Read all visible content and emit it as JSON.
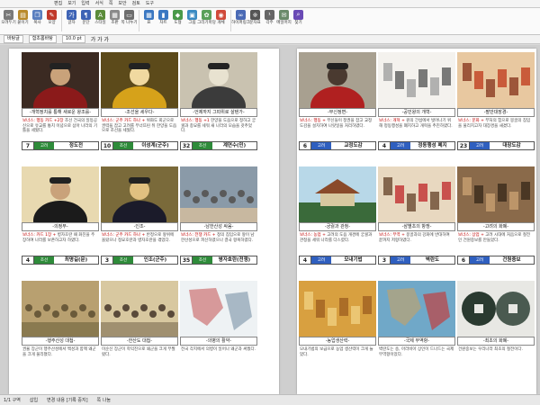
{
  "ribbon_tabs": [
    "편집",
    "보기",
    "입력",
    "서식",
    "쪽",
    "보안",
    "검토",
    "도구"
  ],
  "ribbon": [
    {
      "label": "오려두기",
      "icon": "scissors-icon",
      "color": "#7a7a7a",
      "glyph": "✂"
    },
    {
      "label": "붙이기",
      "icon": "paste-icon",
      "color": "#b98a2b",
      "glyph": "▤"
    },
    {
      "label": "복사",
      "icon": "copy-icon",
      "color": "#5a7fbf",
      "glyph": "❐"
    },
    {
      "label": "모양",
      "icon": "format-copy-icon",
      "color": "#c0392b",
      "glyph": "✎"
    },
    {
      "label": "글자",
      "icon": "char-shape-icon",
      "color": "#3e63b5",
      "glyph": "가"
    },
    {
      "label": "문단",
      "icon": "paragraph-icon",
      "color": "#3e63b5",
      "glyph": "¶"
    },
    {
      "label": "스타일",
      "icon": "style-icon",
      "color": "#5b8c3a",
      "glyph": "A"
    },
    {
      "label": "조판",
      "icon": "layout-icon",
      "color": "#8a8a8a",
      "glyph": "▦"
    },
    {
      "label": "쪽 나누기",
      "icon": "page-break-icon",
      "color": "#6d6d6d",
      "glyph": "▭"
    },
    {
      "label": "표",
      "icon": "table-icon",
      "color": "#3b78c2",
      "glyph": "▦"
    },
    {
      "label": "차트",
      "icon": "chart-icon",
      "color": "#3b78c2",
      "glyph": "▮"
    },
    {
      "label": "도형",
      "icon": "shape-icon",
      "color": "#4a9a4a",
      "glyph": "◆"
    },
    {
      "label": "그림",
      "icon": "picture-icon",
      "color": "#3a8ac2",
      "glyph": "▣"
    },
    {
      "label": "그리기마당",
      "icon": "clipart-icon",
      "color": "#5aa05a",
      "glyph": "✿"
    },
    {
      "label": "개체",
      "icon": "object-icon",
      "color": "#d04a3a",
      "glyph": "◉"
    },
    {
      "label": "하이퍼링크",
      "icon": "link-icon",
      "color": "#4a6ab5",
      "glyph": "∞"
    },
    {
      "label": "문자표",
      "icon": "symbol-icon",
      "color": "#555555",
      "glyph": "※"
    },
    {
      "label": "각주",
      "icon": "footnote-icon",
      "color": "#666666",
      "glyph": "¹"
    },
    {
      "label": "메일머지",
      "icon": "mail-merge-icon",
      "color": "#6a8a6a",
      "glyph": "✉"
    },
    {
      "label": "찾기",
      "icon": "find-icon",
      "color": "#6a4ab5",
      "glyph": "⌕"
    }
  ],
  "format_bar": {
    "style": "바탕글",
    "font": "함초롬바탕",
    "size": "10.0 pt",
    "marks": "가 가 가"
  },
  "cards_left": [
    {
      "num": "7",
      "badge": "고려",
      "badge_color": "g",
      "name": "정도전",
      "title": "-개혁정치를 통해 새로운 왕조를-",
      "desc": "조선 건국의 일등공신으로 유교를 통치 이념으로 삼아 나라의 기틀을 세웠다.",
      "extra": "보너스: 행동 카드 +2장",
      "scene": "portrait-red"
    },
    {
      "num": "10",
      "badge": "조선",
      "badge_color": "g",
      "name": "이성계(군주)",
      "title": "-조선을 세우다-",
      "desc": "위화도 회군으로 권력을 잡고 고려를 무너뜨린 뒤 한양을 도읍으로 조선을 세웠다.",
      "extra": "보너스: 군주 카드 하나 +",
      "scene": "portrait-king"
    },
    {
      "num": "32",
      "badge": "조선",
      "badge_color": "g",
      "name": "계연수(민)",
      "title": "-언제까지 그따위로 살텐가-",
      "desc": "한양을 도읍으로 정하고 궁궐과 종묘를 세워 새 나라의 모습을 갖추었다.",
      "extra": "보너스: 행동 +1",
      "scene": "portrait-poster"
    },
    {
      "num": "4",
      "badge": "조선",
      "badge_color": "g",
      "name": "최명길(문)",
      "title": "-의정부-",
      "desc": "병자호란 때 화친을 주장하여 나라를 보존하고자 하였다.",
      "extra": "보너스: 카드 1장 +",
      "scene": "portrait-black"
    },
    {
      "num": "3",
      "badge": "조선",
      "badge_color": "g",
      "name": "인조(군주)",
      "title": "-인조-",
      "desc": "반정으로 왕위에 올랐으나 정묘호란과 병자호란을 겪었다.",
      "extra": "보너스: 군주 카드 하나 +",
      "scene": "portrait-king2"
    },
    {
      "num": "35",
      "badge": "조선",
      "badge_color": "g",
      "name": "병자호란(전쟁)",
      "title": "-남한산성 싸움-",
      "desc": "청의 침입으로 왕이 남한산성으로 피신하였으나 결국 항복하였다.",
      "extra": "보너스: 전쟁 카드 +",
      "scene": "battle-mountain"
    },
    {
      "num": "",
      "badge": "",
      "badge_color": "g",
      "name": "",
      "title": "-행주산성 대첩-",
      "desc": "권율 장군이 행주산성에서 백성과 함께 왜군을 크게 물리쳤다.",
      "extra": "",
      "scene": "battle-field"
    },
    {
      "num": "",
      "badge": "",
      "badge_color": "g",
      "name": "",
      "title": "-한산도 대첩-",
      "desc": "이순신 장군이 학익진으로 왜군을 크게 무찔렀다.",
      "extra": "",
      "scene": "battle-ink"
    },
    {
      "num": "",
      "badge": "",
      "badge_color": "g",
      "name": "",
      "title": "-의병의 활약-",
      "desc": "전국 각지에서 의병이 일어나 왜군과 싸웠다.",
      "extra": "",
      "scene": "map"
    }
  ],
  "cards_right": [
    {
      "num": "6",
      "badge": "고려",
      "badge_color": "b",
      "name": "교정도감",
      "title": "-무신정변-",
      "desc": "무신들이 정권을 잡고 교정도감을 설치하여 나랏일을 처리하였다.",
      "extra": "보너스: 행동 +",
      "scene": "portrait-red2"
    },
    {
      "num": "4",
      "badge": "고려",
      "badge_color": "b",
      "name": "정동행성 폐지",
      "title": "-공민왕의 개혁-",
      "desc": "원의 간섭에서 벗어나기 위해 정동행성을 폐지하고 개혁을 추진하였다.",
      "extra": "보너스: 개혁 +",
      "scene": "sketch"
    },
    {
      "num": "23",
      "badge": "고려",
      "badge_color": "b",
      "name": "대장도감",
      "title": "-팔만대장경-",
      "desc": "부처의 힘으로 몽골의 침입을 물리치고자 대장경을 새겼다.",
      "extra": "보너스: 문화 +",
      "scene": "fire"
    },
    {
      "num": "4",
      "badge": "고려",
      "badge_color": "b",
      "name": "모내기법",
      "title": "-궁궐과 관청-",
      "desc": "고려의 도읍 개경에 궁궐과 관청을 세워 나라를 다스렸다.",
      "extra": "보너스: 농업 +",
      "scene": "palace"
    },
    {
      "num": "3",
      "badge": "고려",
      "badge_color": "b",
      "name": "벽란도",
      "title": "-삼별초의 항쟁-",
      "desc": "몽골과의 강화에 반대하여 끝까지 저항하였다.",
      "extra": "보너스: 무역 +",
      "scene": "scribble"
    },
    {
      "num": "6",
      "badge": "고려",
      "badge_color": "b",
      "name": "건원중보",
      "title": "-고려의 화폐-",
      "desc": "고려 시대에 처음으로 철전인 건원중보를 만들었다.",
      "extra": "보너스: 상업 +",
      "scene": "scholars"
    },
    {
      "num": "",
      "badge": "",
      "badge_color": "b",
      "name": "",
      "title": "-농업생산력-",
      "desc": "모내기법의 보급으로 농업 생산력이 크게 늘었다.",
      "extra": "",
      "scene": "gold"
    },
    {
      "num": "",
      "badge": "",
      "badge_color": "b",
      "name": "",
      "title": "-국제 무역항-",
      "desc": "벽란도는 송, 아라비아 상인이 드나드는 국제 무역항이었다.",
      "extra": "",
      "scene": "seamap"
    },
    {
      "num": "",
      "badge": "",
      "badge_color": "b",
      "name": "",
      "title": "-최초의 화폐-",
      "desc": "건원중보는 우리나라 최초의 철전이다.",
      "extra": "",
      "scene": "coins"
    }
  ],
  "status_bar": [
    "1/1 구역",
    "삽입",
    "변경 내용 [기록 중지]",
    "쪽 나눔"
  ]
}
